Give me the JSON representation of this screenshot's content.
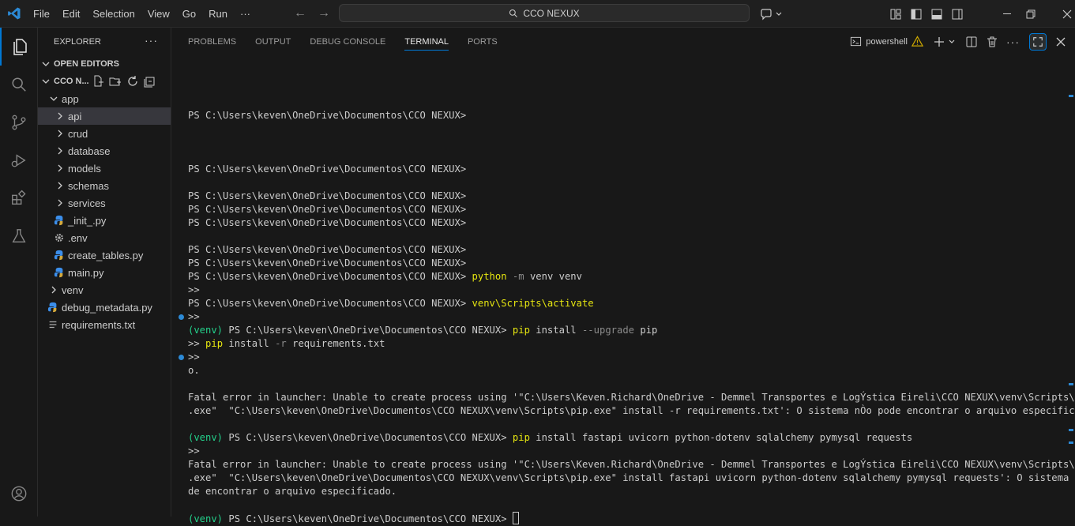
{
  "window": {
    "search_text": "CCO NEXUX",
    "menu": [
      "File",
      "Edit",
      "Selection",
      "View",
      "Go",
      "Run",
      "···"
    ]
  },
  "sidebar": {
    "title": "EXPLORER",
    "more": "···",
    "open_editors": "OPEN EDITORS",
    "project": "CCO N...",
    "tree": [
      {
        "label": "app",
        "type": "folder-open",
        "depth": 1
      },
      {
        "label": "api",
        "type": "folder",
        "depth": 2,
        "selected": true
      },
      {
        "label": "crud",
        "type": "folder",
        "depth": 2
      },
      {
        "label": "database",
        "type": "folder",
        "depth": 2
      },
      {
        "label": "models",
        "type": "folder",
        "depth": 2
      },
      {
        "label": "schemas",
        "type": "folder",
        "depth": 2
      },
      {
        "label": "services",
        "type": "folder",
        "depth": 2
      },
      {
        "label": "_init_.py",
        "type": "python",
        "depth": 2
      },
      {
        "label": ".env",
        "type": "gear",
        "depth": 2
      },
      {
        "label": "create_tables.py",
        "type": "python",
        "depth": 2
      },
      {
        "label": "main.py",
        "type": "python",
        "depth": 2
      },
      {
        "label": "venv",
        "type": "folder",
        "depth": 1
      },
      {
        "label": "debug_metadata.py",
        "type": "python",
        "depth": 1
      },
      {
        "label": "requirements.txt",
        "type": "text",
        "depth": 1
      }
    ]
  },
  "panel": {
    "tabs": [
      "PROBLEMS",
      "OUTPUT",
      "DEBUG CONSOLE",
      "TERMINAL",
      "PORTS"
    ],
    "active_tab": "TERMINAL",
    "shell": "powershell"
  },
  "terminal": {
    "lines": [
      [],
      [],
      [],
      [
        {
          "t": "PS C:\\Users\\keven\\OneDrive\\Documentos\\CCO NEXUX>"
        }
      ],
      [],
      [],
      [],
      [
        {
          "t": "PS C:\\Users\\keven\\OneDrive\\Documentos\\CCO NEXUX>"
        }
      ],
      [],
      [
        {
          "t": "PS C:\\Users\\keven\\OneDrive\\Documentos\\CCO NEXUX>"
        }
      ],
      [
        {
          "t": "PS C:\\Users\\keven\\OneDrive\\Documentos\\CCO NEXUX>"
        }
      ],
      [
        {
          "t": "PS C:\\Users\\keven\\OneDrive\\Documentos\\CCO NEXUX>"
        }
      ],
      [],
      [
        {
          "t": "PS C:\\Users\\keven\\OneDrive\\Documentos\\CCO NEXUX>"
        }
      ],
      [
        {
          "t": "PS C:\\Users\\keven\\OneDrive\\Documentos\\CCO NEXUX>"
        }
      ],
      [
        {
          "t": "PS C:\\Users\\keven\\OneDrive\\Documentos\\CCO NEXUX> "
        },
        {
          "t": "python",
          "c": "cmd"
        },
        {
          "t": " "
        },
        {
          "t": "-m",
          "c": "flag"
        },
        {
          "t": " venv venv"
        }
      ],
      [
        {
          "t": ">>"
        }
      ],
      [
        {
          "t": "PS C:\\Users\\keven\\OneDrive\\Documentos\\CCO NEXUX> "
        },
        {
          "t": "venv\\Scripts\\activate",
          "c": "cmd"
        }
      ],
      [
        {
          "t": ">>",
          "dot": true
        }
      ],
      [
        {
          "t": "(venv)",
          "c": "venv"
        },
        {
          "t": " PS C:\\Users\\keven\\OneDrive\\Documentos\\CCO NEXUX> "
        },
        {
          "t": "pip",
          "c": "cmd"
        },
        {
          "t": " install "
        },
        {
          "t": "--upgrade",
          "c": "flag"
        },
        {
          "t": " pip"
        }
      ],
      [
        {
          "t": ">> "
        },
        {
          "t": "pip",
          "c": "cmd"
        },
        {
          "t": " install "
        },
        {
          "t": "-r",
          "c": "flag"
        },
        {
          "t": " requirements.txt"
        }
      ],
      [
        {
          "t": ">>",
          "dot": true
        }
      ],
      [
        {
          "t": "o."
        }
      ],
      [],
      [
        {
          "t": "Fatal error in launcher: Unable to create process using '\"C:\\Users\\Keven.Richard\\OneDrive - Demmel Transportes e LogÝstica Eireli\\CCO NEXUX\\venv\\Scripts\\python"
        }
      ],
      [
        {
          "t": ".exe\"  \"C:\\Users\\keven\\OneDrive\\Documentos\\CCO NEXUX\\venv\\Scripts\\pip.exe\" install -r requirements.txt': O sistema nÒo pode encontrar o arquivo especificado."
        }
      ],
      [],
      [
        {
          "t": "(venv)",
          "c": "venv"
        },
        {
          "t": " PS C:\\Users\\keven\\OneDrive\\Documentos\\CCO NEXUX> "
        },
        {
          "t": "pip",
          "c": "cmd"
        },
        {
          "t": " install fastapi uvicorn python-dotenv sqlalchemy pymysql requests"
        }
      ],
      [
        {
          "t": ">>"
        }
      ],
      [
        {
          "t": "Fatal error in launcher: Unable to create process using '\"C:\\Users\\Keven.Richard\\OneDrive - Demmel Transportes e LogÝstica Eireli\\CCO NEXUX\\venv\\Scripts\\python"
        }
      ],
      [
        {
          "t": ".exe\"  \"C:\\Users\\keven\\OneDrive\\Documentos\\CCO NEXUX\\venv\\Scripts\\pip.exe\" install fastapi uvicorn python-dotenv sqlalchemy pymysql requests': O sistema nÒo po"
        }
      ],
      [
        {
          "t": "de encontrar o arquivo especificado."
        }
      ],
      [],
      [
        {
          "t": "(venv)",
          "c": "venv"
        },
        {
          "t": " PS C:\\Users\\keven\\OneDrive\\Documentos\\CCO NEXUX> "
        },
        {
          "cursor": true
        }
      ]
    ]
  },
  "colors": {
    "accent": "#0078d4",
    "warning": "#cca700",
    "command": "#e5e510",
    "venv": "#23d18b",
    "python_icon": "#3b8eea"
  }
}
